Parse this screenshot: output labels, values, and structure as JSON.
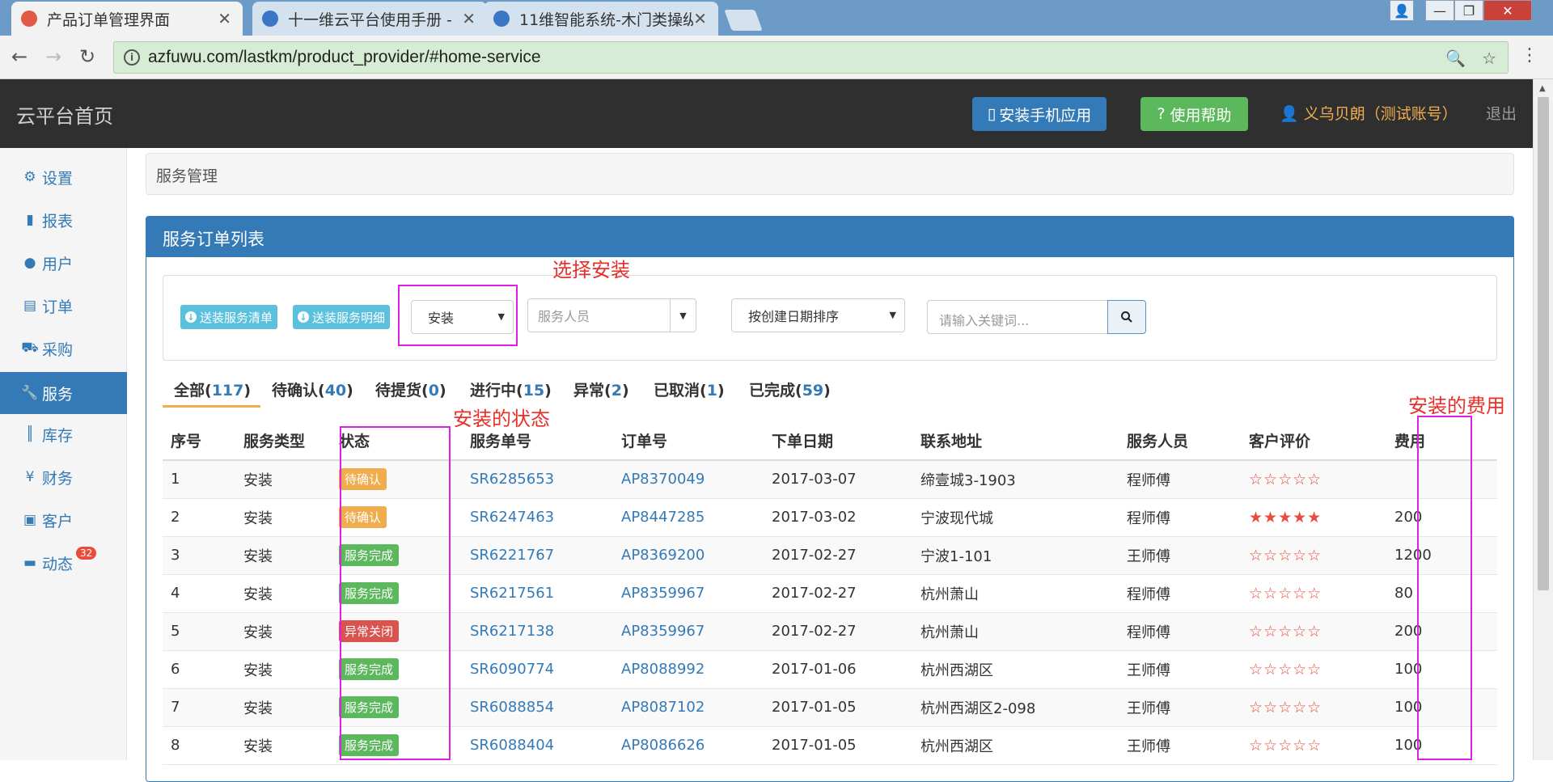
{
  "browser": {
    "tabs": [
      {
        "title": "产品订单管理界面",
        "active": true
      },
      {
        "title": "十一维云平台使用手册 -",
        "active": false
      },
      {
        "title": "11维智能系统-木门类操纵",
        "active": false
      }
    ],
    "url": "azfuwu.com/lastkm/product_provider/#home-service"
  },
  "header": {
    "brand": "云平台首页",
    "install_app": "安装手机应用",
    "help": "使用帮助",
    "user": "义乌贝朗（测试账号）",
    "logout": "退出"
  },
  "sidebar": {
    "items": [
      {
        "label": "设置",
        "icon": "gear-icon"
      },
      {
        "label": "报表",
        "icon": "bar-chart-icon"
      },
      {
        "label": "用户",
        "icon": "user-icon"
      },
      {
        "label": "订单",
        "icon": "list-icon"
      },
      {
        "label": "采购",
        "icon": "cart-icon"
      },
      {
        "label": "服务",
        "icon": "wrench-icon",
        "active": true
      },
      {
        "label": "库存",
        "icon": "barcode-icon"
      },
      {
        "label": "财务",
        "icon": "yen-icon"
      },
      {
        "label": "客户",
        "icon": "briefcase-icon"
      },
      {
        "label": "动态",
        "icon": "comment-icon",
        "badge": "32"
      }
    ]
  },
  "breadcrumb": "服务管理",
  "panel": {
    "title": "服务订单列表",
    "send_list": "送装服务清单",
    "send_detail": "送装服务明细",
    "type_select": "安装",
    "staff_placeholder": "服务人员",
    "sort_select": "按创建日期排序",
    "search_placeholder": "请输入关键词..."
  },
  "order_tabs": [
    {
      "label": "全部",
      "count": "117",
      "active": true
    },
    {
      "label": "待确认",
      "count": "40"
    },
    {
      "label": "待提货",
      "count": "0"
    },
    {
      "label": "进行中",
      "count": "15"
    },
    {
      "label": "异常",
      "count": "2"
    },
    {
      "label": "已取消",
      "count": "1"
    },
    {
      "label": "已完成",
      "count": "59"
    }
  ],
  "table": {
    "headers": [
      "序号",
      "服务类型",
      "状态",
      "服务单号",
      "订单号",
      "下单日期",
      "联系地址",
      "服务人员",
      "客户评价",
      "费用"
    ],
    "rows": [
      {
        "no": "1",
        "type": "安装",
        "status": "待确认",
        "status_color": "#f0ad4e",
        "sr": "SR6285653",
        "ap": "AP8370049",
        "date": "2017-03-07",
        "addr": "缔壹城3-1903",
        "staff": "程师傅",
        "rating": "☆☆☆☆☆",
        "fee": ""
      },
      {
        "no": "2",
        "type": "安装",
        "status": "待确认",
        "status_color": "#f0ad4e",
        "sr": "SR6247463",
        "ap": "AP8447285",
        "date": "2017-03-02",
        "addr": "宁波现代城",
        "staff": "程师傅",
        "rating": "★★★★★",
        "fee": "200"
      },
      {
        "no": "3",
        "type": "安装",
        "status": "服务完成",
        "status_color": "#5cb85c",
        "sr": "SR6221767",
        "ap": "AP8369200",
        "date": "2017-02-27",
        "addr": "宁波1-101",
        "staff": "王师傅",
        "rating": "☆☆☆☆☆",
        "fee": "1200"
      },
      {
        "no": "4",
        "type": "安装",
        "status": "服务完成",
        "status_color": "#5cb85c",
        "sr": "SR6217561",
        "ap": "AP8359967",
        "date": "2017-02-27",
        "addr": "杭州萧山",
        "staff": "程师傅",
        "rating": "☆☆☆☆☆",
        "fee": "80"
      },
      {
        "no": "5",
        "type": "安装",
        "status": "异常关闭",
        "status_color": "#d9534f",
        "sr": "SR6217138",
        "ap": "AP8359967",
        "date": "2017-02-27",
        "addr": "杭州萧山",
        "staff": "程师傅",
        "rating": "☆☆☆☆☆",
        "fee": "200"
      },
      {
        "no": "6",
        "type": "安装",
        "status": "服务完成",
        "status_color": "#5cb85c",
        "sr": "SR6090774",
        "ap": "AP8088992",
        "date": "2017-01-06",
        "addr": "杭州西湖区",
        "staff": "王师傅",
        "rating": "☆☆☆☆☆",
        "fee": "100"
      },
      {
        "no": "7",
        "type": "安装",
        "status": "服务完成",
        "status_color": "#5cb85c",
        "sr": "SR6088854",
        "ap": "AP8087102",
        "date": "2017-01-05",
        "addr": "杭州西湖区2-098",
        "staff": "王师傅",
        "rating": "☆☆☆☆☆",
        "fee": "100"
      },
      {
        "no": "8",
        "type": "安装",
        "status": "服务完成",
        "status_color": "#5cb85c",
        "sr": "SR6088404",
        "ap": "AP8086626",
        "date": "2017-01-05",
        "addr": "杭州西湖区",
        "staff": "王师傅",
        "rating": "☆☆☆☆☆",
        "fee": "100"
      }
    ]
  },
  "annotations": {
    "select_install": "选择安装",
    "install_status": "安装的状态",
    "install_fee": "安装的费用"
  },
  "colors": {
    "primary": "#337ab7",
    "success": "#5cb85c",
    "warning": "#f0ad4e",
    "danger": "#d9534f",
    "annotation": "#e020e0"
  }
}
